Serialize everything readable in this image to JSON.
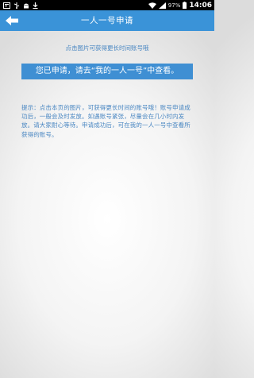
{
  "status_bar": {
    "battery_percent": "97%",
    "time": "14:06",
    "icons": [
      "notification-icon",
      "usb-icon",
      "android-icon",
      "download-icon",
      "wifi-icon",
      "signal-icon",
      "battery-icon"
    ]
  },
  "title_bar": {
    "back_icon": "arrow-left-icon",
    "title": "一人一号申请"
  },
  "main": {
    "hint": "点击图片可获得更长时间账号哦",
    "result_message": "您已申请，请去“我的一人一号”中查看。",
    "tip": "提示：点击本页的图片，可获得更长时间的账号哦！账号申请成功后，一般会及时发放。如遇账号紧张，尽量会在几小时内发放。请大家耐心等待。申请成功后，可在我的一人一号中查看所获得的账号。"
  },
  "colors": {
    "title_bar": "#3a93d8",
    "result_box": "#3f8fd3",
    "text_blue": "#4a87c2",
    "status_bar": "#000000"
  }
}
